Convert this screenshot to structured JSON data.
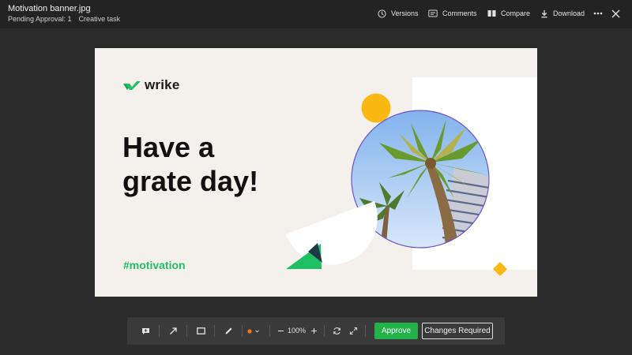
{
  "file": {
    "name": "Motivation banner.jpg",
    "pending_approval": "Pending Approval: 1",
    "task": "Creative task"
  },
  "header_actions": {
    "versions": "Versions",
    "comments": "Comments",
    "compare": "Compare",
    "download": "Download"
  },
  "banner": {
    "logo_text": "wrike",
    "headline_line1": "Have a",
    "headline_line2": "grate day!",
    "hashtag": "#motivation"
  },
  "toolbar": {
    "zoom_level": "100%",
    "approve_label": "Approve",
    "changes_label": "Changes Required",
    "color_swatch": "#f07a1c"
  },
  "colors": {
    "brand_green": "#1fbf63",
    "approve_green": "#21b24a",
    "accent_yellow": "#fbb812",
    "circle_outline": "#6f52c9"
  }
}
